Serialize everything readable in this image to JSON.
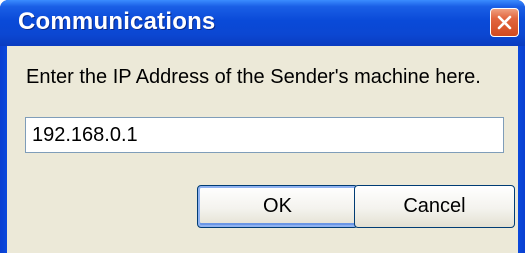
{
  "window": {
    "title": "Communications",
    "close_icon": "close-icon"
  },
  "dialog": {
    "prompt": "Enter the IP Address of the Sender's machine here.",
    "ip_value": "192.168.0.1",
    "ok_label": "OK",
    "cancel_label": "Cancel"
  },
  "colors": {
    "titlebar": "#0a4ad8",
    "client_bg": "#ece9d8",
    "close_button": "#d24a20",
    "input_border": "#7f9db9",
    "button_border": "#003c74"
  }
}
